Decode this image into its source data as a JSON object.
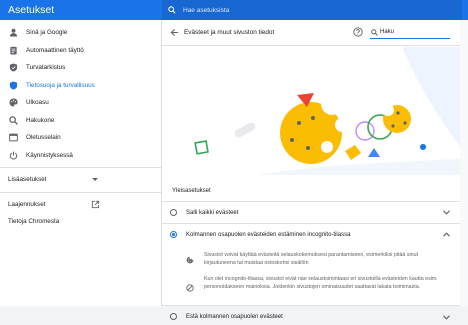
{
  "app": {
    "title": "Asetukset"
  },
  "search": {
    "placeholder": "Hae asetuksista"
  },
  "sidebar": {
    "items": [
      {
        "label": "Sinä ja Google",
        "icon": "person-icon"
      },
      {
        "label": "Automaattinen täyttö",
        "icon": "clipboard-icon"
      },
      {
        "label": "Turvatarkistus",
        "icon": "shield-check-icon"
      },
      {
        "label": "Tietosuoja ja turvallisuus",
        "icon": "shield-icon"
      },
      {
        "label": "Ulkoasu",
        "icon": "palette-icon"
      },
      {
        "label": "Hakukone",
        "icon": "search-icon"
      },
      {
        "label": "Oletusselain",
        "icon": "browser-icon"
      },
      {
        "label": "Käynnistyksessä",
        "icon": "power-icon"
      }
    ],
    "advanced": "Lisäasetukset",
    "extensions": "Laajennukset",
    "about": "Tietoja Chromesta"
  },
  "page": {
    "title": "Evästeet ja muut sivuston tiedot",
    "search_placeholder": "Haku",
    "section": "Yleisasetukset",
    "options": [
      {
        "label": "Salli kaikki evästeet",
        "selected": false
      },
      {
        "label": "Kolmannen osapuolen evästeiden estäminen incognito-tilassa",
        "selected": true
      },
      {
        "label": "Estä kolmannen osapuolen evästeet",
        "selected": false
      }
    ],
    "desc1": "Sivustot voivat käyttää evästeitä selauskokemuksesi parantamiseen, esimerkiksi pitää sinut kirjautuneena tai muistaa ostoskorisi sisällön",
    "desc2": "Kun olet incognito-tilassa, sivustot eivät näe selaustoimintaasi eri sivustoilla evästeiden kautta esim. personoidakseen mainoksia. Joidenkin sivustojen ominaisuudet saattavat lakata toimimasta."
  },
  "colors": {
    "accent": "#1a73e8",
    "cookie": "#fbbc04"
  }
}
